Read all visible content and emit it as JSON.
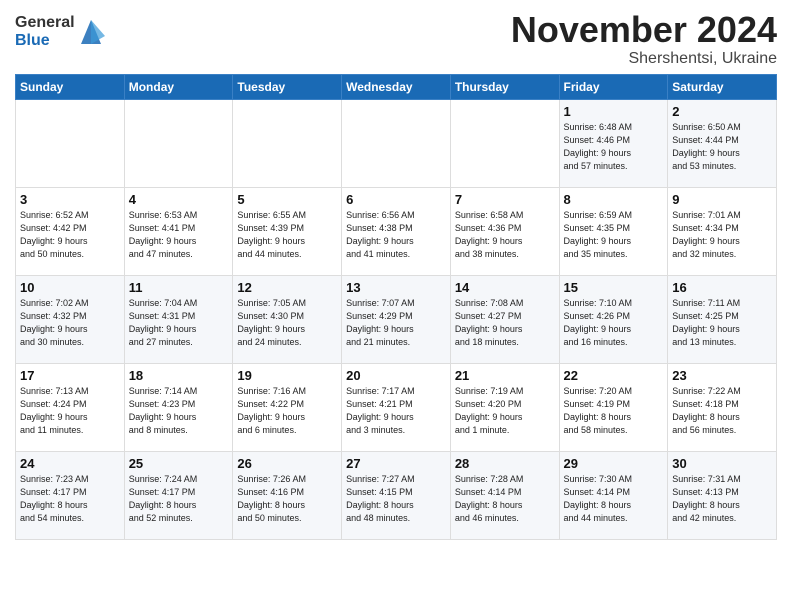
{
  "logo": {
    "line1": "General",
    "line2": "Blue"
  },
  "header": {
    "month": "November 2024",
    "location": "Shershentsi, Ukraine"
  },
  "weekdays": [
    "Sunday",
    "Monday",
    "Tuesday",
    "Wednesday",
    "Thursday",
    "Friday",
    "Saturday"
  ],
  "weeks": [
    [
      {
        "day": "",
        "info": ""
      },
      {
        "day": "",
        "info": ""
      },
      {
        "day": "",
        "info": ""
      },
      {
        "day": "",
        "info": ""
      },
      {
        "day": "",
        "info": ""
      },
      {
        "day": "1",
        "info": "Sunrise: 6:48 AM\nSunset: 4:46 PM\nDaylight: 9 hours\nand 57 minutes."
      },
      {
        "day": "2",
        "info": "Sunrise: 6:50 AM\nSunset: 4:44 PM\nDaylight: 9 hours\nand 53 minutes."
      }
    ],
    [
      {
        "day": "3",
        "info": "Sunrise: 6:52 AM\nSunset: 4:42 PM\nDaylight: 9 hours\nand 50 minutes."
      },
      {
        "day": "4",
        "info": "Sunrise: 6:53 AM\nSunset: 4:41 PM\nDaylight: 9 hours\nand 47 minutes."
      },
      {
        "day": "5",
        "info": "Sunrise: 6:55 AM\nSunset: 4:39 PM\nDaylight: 9 hours\nand 44 minutes."
      },
      {
        "day": "6",
        "info": "Sunrise: 6:56 AM\nSunset: 4:38 PM\nDaylight: 9 hours\nand 41 minutes."
      },
      {
        "day": "7",
        "info": "Sunrise: 6:58 AM\nSunset: 4:36 PM\nDaylight: 9 hours\nand 38 minutes."
      },
      {
        "day": "8",
        "info": "Sunrise: 6:59 AM\nSunset: 4:35 PM\nDaylight: 9 hours\nand 35 minutes."
      },
      {
        "day": "9",
        "info": "Sunrise: 7:01 AM\nSunset: 4:34 PM\nDaylight: 9 hours\nand 32 minutes."
      }
    ],
    [
      {
        "day": "10",
        "info": "Sunrise: 7:02 AM\nSunset: 4:32 PM\nDaylight: 9 hours\nand 30 minutes."
      },
      {
        "day": "11",
        "info": "Sunrise: 7:04 AM\nSunset: 4:31 PM\nDaylight: 9 hours\nand 27 minutes."
      },
      {
        "day": "12",
        "info": "Sunrise: 7:05 AM\nSunset: 4:30 PM\nDaylight: 9 hours\nand 24 minutes."
      },
      {
        "day": "13",
        "info": "Sunrise: 7:07 AM\nSunset: 4:29 PM\nDaylight: 9 hours\nand 21 minutes."
      },
      {
        "day": "14",
        "info": "Sunrise: 7:08 AM\nSunset: 4:27 PM\nDaylight: 9 hours\nand 18 minutes."
      },
      {
        "day": "15",
        "info": "Sunrise: 7:10 AM\nSunset: 4:26 PM\nDaylight: 9 hours\nand 16 minutes."
      },
      {
        "day": "16",
        "info": "Sunrise: 7:11 AM\nSunset: 4:25 PM\nDaylight: 9 hours\nand 13 minutes."
      }
    ],
    [
      {
        "day": "17",
        "info": "Sunrise: 7:13 AM\nSunset: 4:24 PM\nDaylight: 9 hours\nand 11 minutes."
      },
      {
        "day": "18",
        "info": "Sunrise: 7:14 AM\nSunset: 4:23 PM\nDaylight: 9 hours\nand 8 minutes."
      },
      {
        "day": "19",
        "info": "Sunrise: 7:16 AM\nSunset: 4:22 PM\nDaylight: 9 hours\nand 6 minutes."
      },
      {
        "day": "20",
        "info": "Sunrise: 7:17 AM\nSunset: 4:21 PM\nDaylight: 9 hours\nand 3 minutes."
      },
      {
        "day": "21",
        "info": "Sunrise: 7:19 AM\nSunset: 4:20 PM\nDaylight: 9 hours\nand 1 minute."
      },
      {
        "day": "22",
        "info": "Sunrise: 7:20 AM\nSunset: 4:19 PM\nDaylight: 8 hours\nand 58 minutes."
      },
      {
        "day": "23",
        "info": "Sunrise: 7:22 AM\nSunset: 4:18 PM\nDaylight: 8 hours\nand 56 minutes."
      }
    ],
    [
      {
        "day": "24",
        "info": "Sunrise: 7:23 AM\nSunset: 4:17 PM\nDaylight: 8 hours\nand 54 minutes."
      },
      {
        "day": "25",
        "info": "Sunrise: 7:24 AM\nSunset: 4:17 PM\nDaylight: 8 hours\nand 52 minutes."
      },
      {
        "day": "26",
        "info": "Sunrise: 7:26 AM\nSunset: 4:16 PM\nDaylight: 8 hours\nand 50 minutes."
      },
      {
        "day": "27",
        "info": "Sunrise: 7:27 AM\nSunset: 4:15 PM\nDaylight: 8 hours\nand 48 minutes."
      },
      {
        "day": "28",
        "info": "Sunrise: 7:28 AM\nSunset: 4:14 PM\nDaylight: 8 hours\nand 46 minutes."
      },
      {
        "day": "29",
        "info": "Sunrise: 7:30 AM\nSunset: 4:14 PM\nDaylight: 8 hours\nand 44 minutes."
      },
      {
        "day": "30",
        "info": "Sunrise: 7:31 AM\nSunset: 4:13 PM\nDaylight: 8 hours\nand 42 minutes."
      }
    ]
  ]
}
